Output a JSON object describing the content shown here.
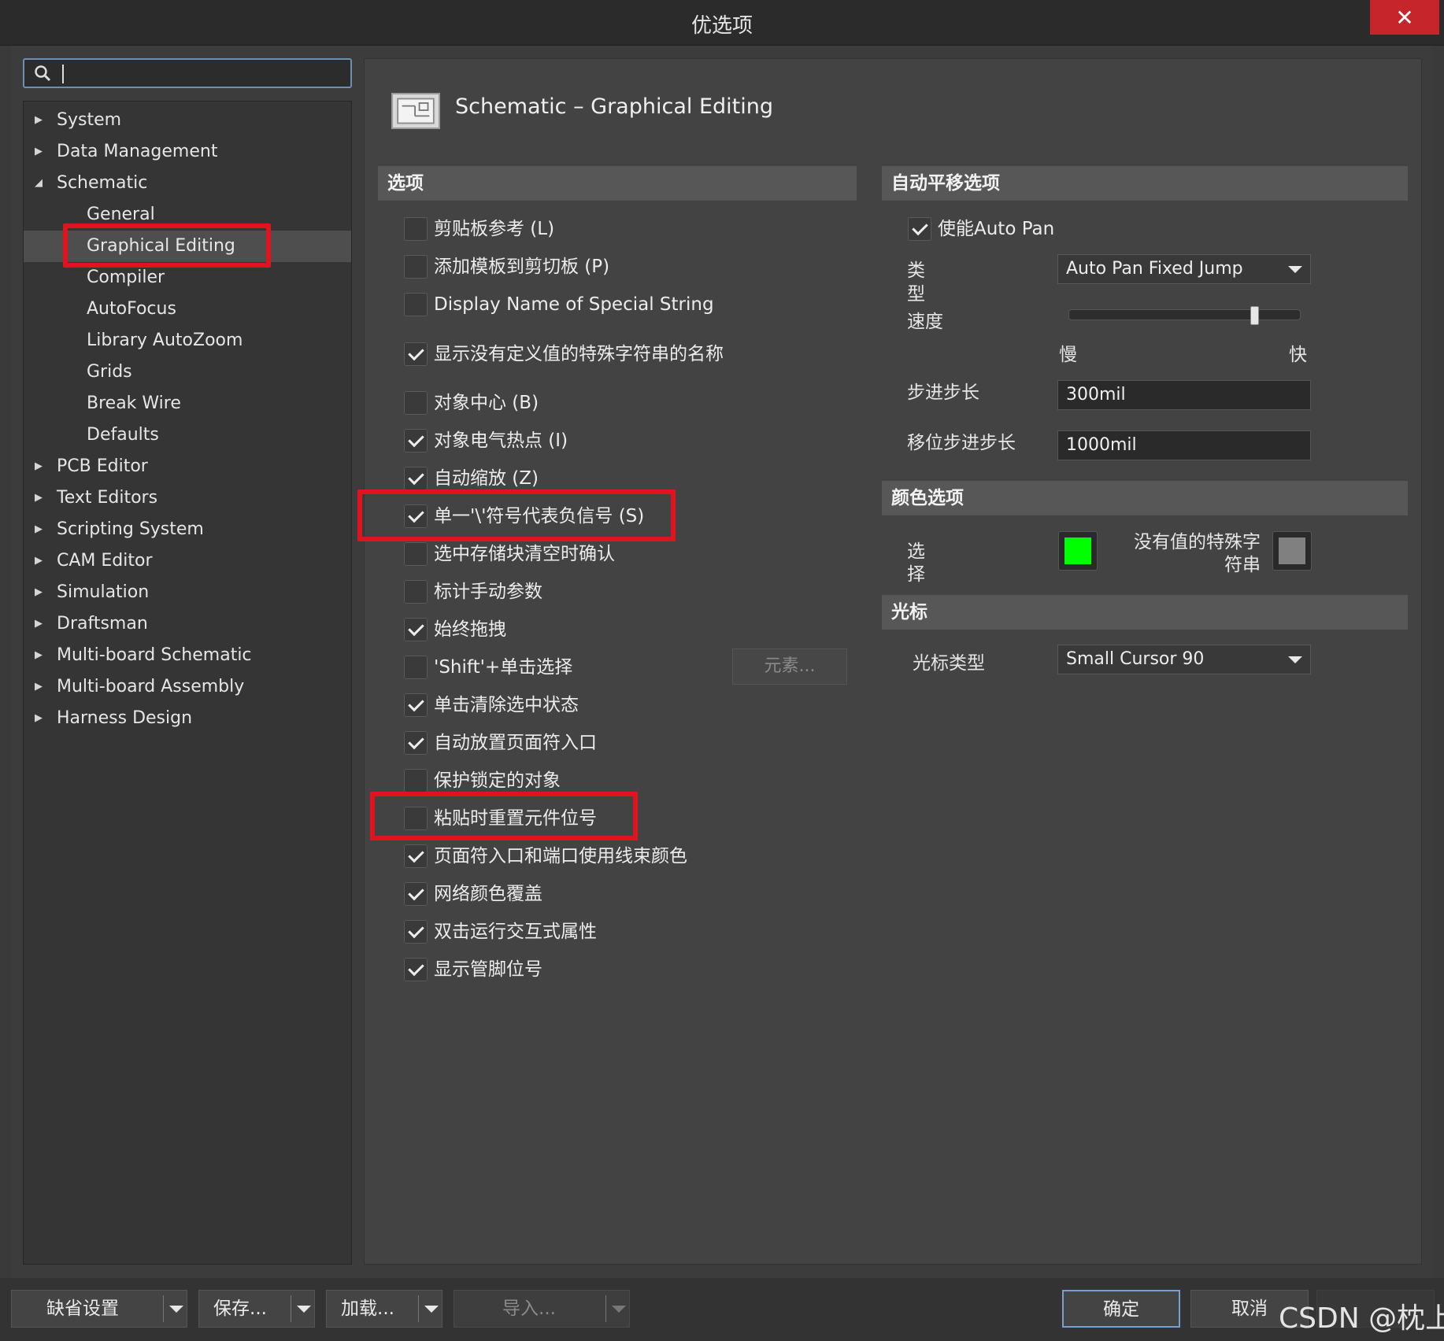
{
  "window": {
    "title": "优选项",
    "close_glyph": "✕"
  },
  "search": {
    "value": "",
    "placeholder": ""
  },
  "tree": {
    "items": [
      {
        "label": "System",
        "arrow": "▶"
      },
      {
        "label": "Data Management",
        "arrow": "▶"
      },
      {
        "label": "Schematic",
        "arrow": "◢"
      },
      {
        "label": "General"
      },
      {
        "label": "Graphical Editing",
        "selected": true
      },
      {
        "label": "Compiler"
      },
      {
        "label": "AutoFocus"
      },
      {
        "label": "Library AutoZoom"
      },
      {
        "label": "Grids"
      },
      {
        "label": "Break Wire"
      },
      {
        "label": "Defaults"
      },
      {
        "label": "PCB Editor",
        "arrow": "▶"
      },
      {
        "label": "Text Editors",
        "arrow": "▶"
      },
      {
        "label": "Scripting System",
        "arrow": "▶"
      },
      {
        "label": "CAM Editor",
        "arrow": "▶"
      },
      {
        "label": "Simulation",
        "arrow": "▶"
      },
      {
        "label": "Draftsman",
        "arrow": "▶"
      },
      {
        "label": "Multi-board Schematic",
        "arrow": "▶"
      },
      {
        "label": "Multi-board Assembly",
        "arrow": "▶"
      },
      {
        "label": "Harness Design",
        "arrow": "▶"
      }
    ]
  },
  "page": {
    "title": "Schematic – Graphical Editing"
  },
  "options": {
    "header": "选项",
    "items": [
      {
        "label": "剪贴板参考 (L)",
        "checked": false
      },
      {
        "label": "添加模板到剪切板 (P)",
        "checked": false
      },
      {
        "label": "Display Name of Special String",
        "checked": false
      },
      {
        "label": "显示没有定义值的特殊字符串的名称",
        "checked": true
      },
      {
        "label": "对象中心 (B)",
        "checked": false
      },
      {
        "label": "对象电气热点 (I)",
        "checked": true
      },
      {
        "label": "自动缩放 (Z)",
        "checked": true
      },
      {
        "label": "单一'\\'符号代表负信号 (S)",
        "checked": true
      },
      {
        "label": "选中存储块清空时确认",
        "checked": false
      },
      {
        "label": "标计手动参数",
        "checked": false
      },
      {
        "label": "始终拖拽",
        "checked": true
      },
      {
        "label": "'Shift'+单击选择",
        "checked": false
      },
      {
        "label": "单击清除选中状态",
        "checked": true
      },
      {
        "label": "自动放置页面符入口",
        "checked": true
      },
      {
        "label": "保护锁定的对象",
        "checked": false
      },
      {
        "label": "粘贴时重置元件位号",
        "checked": false
      },
      {
        "label": "页面符入口和端口使用线束颜色",
        "checked": true
      },
      {
        "label": "网络颜色覆盖",
        "checked": true
      },
      {
        "label": "双击运行交互式属性",
        "checked": true
      },
      {
        "label": "显示管脚位号",
        "checked": true
      }
    ],
    "elements_button": "元素..."
  },
  "autopan": {
    "header": "自动平移选项",
    "enable_label": "使能Auto Pan",
    "enable_checked": true,
    "type_label_1": "类",
    "type_label_2": "型",
    "type_value": "Auto Pan Fixed Jump",
    "speed_label": "速度",
    "speed_slow": "慢",
    "speed_fast": "快",
    "speed_level": 0.8,
    "step_label": "步进步长",
    "step_value": "300mil",
    "shift_step_label": "移位步进步长",
    "shift_step_value": "1000mil"
  },
  "color": {
    "header": "颜色选项",
    "select_label_1": "选",
    "select_label_2": "择",
    "select_color": "#00ff00",
    "nonvalue_label_1": "没有值的特殊字",
    "nonvalue_label_2": "符串",
    "nonvalue_color": "#808080"
  },
  "cursor": {
    "header": "光标",
    "type_label": "光标类型",
    "type_value": "Small Cursor 90"
  },
  "footer": {
    "default_settings": "缺省设置",
    "save": "保存...",
    "load": "加载...",
    "import": "导入...",
    "ok": "确定",
    "cancel": "取消",
    "watermark": "CSDN @枕上"
  },
  "colors": {
    "highlight": "#e0141f",
    "accent": "#7a9fcf"
  }
}
